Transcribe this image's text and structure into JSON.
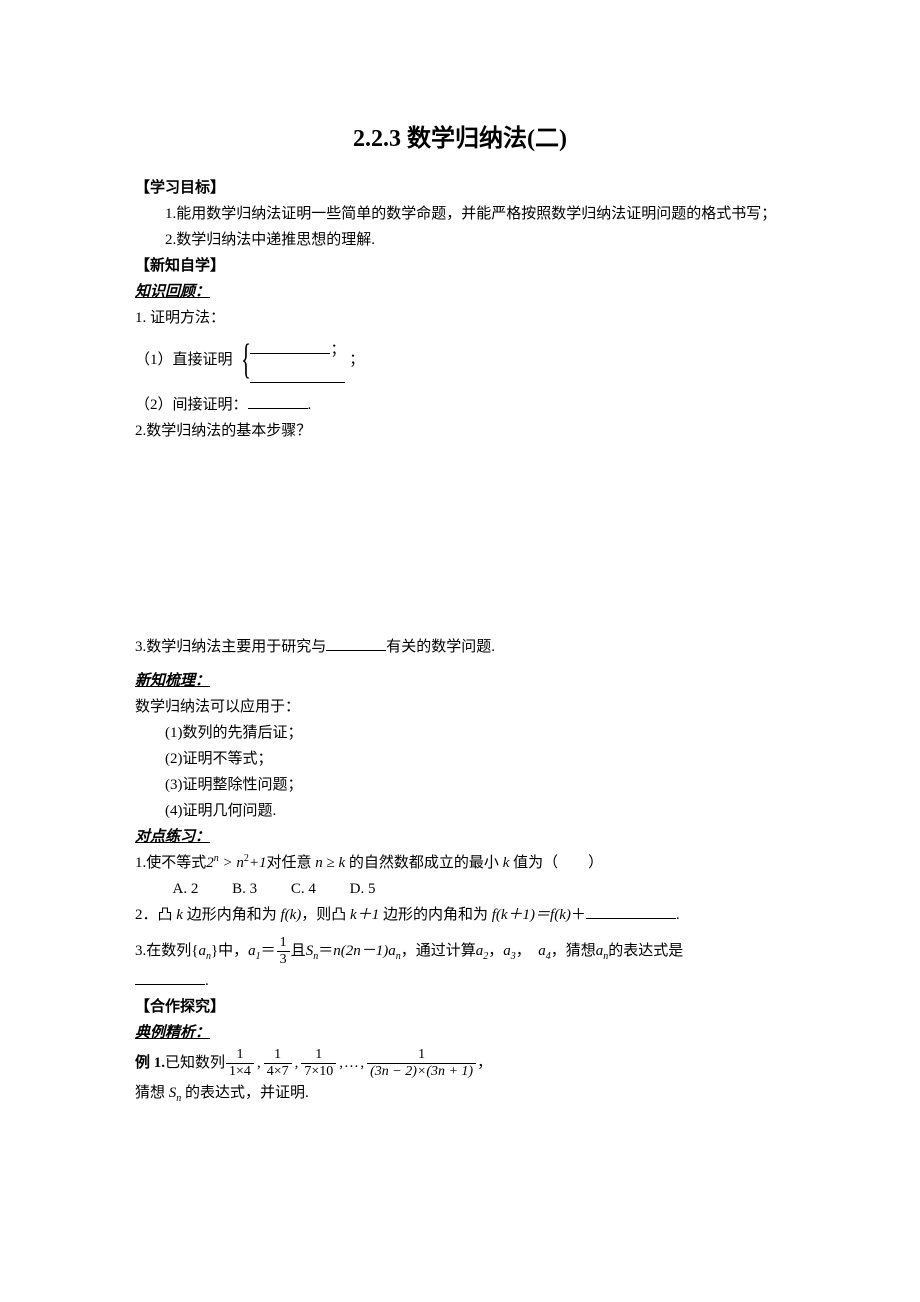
{
  "title": "2.2.3 数学归纳法(二)",
  "sections": {
    "obj_label": "【学习目标】",
    "obj1": "1.能用数学归纳法证明一些简单的数学命题，并能严格按照数学归纳法证明问题的格式书写；",
    "obj2": "2.数学归纳法中递推思想的理解.",
    "newknow_label": "【新知自学】",
    "review_label": "知识回顾：",
    "review1": "1. 证明方法：",
    "review1a": "（1）直接证明",
    "review1b_suffix": "；",
    "review1c_top_suffix": "；",
    "review2": "（2）间接证明：",
    "review2_period": ".",
    "review3": "2.数学归纳法的基本步骤？",
    "review4_pre": "3.数学归纳法主要用于研究与",
    "review4_post": "有关的数学问题.",
    "comb_label": "新知梳理：",
    "comb_intro": "数学归纳法可以应用于：",
    "comb_items": [
      "(1)数列的先猜后证；",
      "(2)证明不等式；",
      "(3)证明整除性问题；",
      "(4)证明几何问题."
    ],
    "exercise_label": "对点练习：",
    "ex1_pre": "1.使不等式",
    "ex1_mid": "对任意",
    "ex1_post": "的自然数都成立的最小",
    "ex1_tail": "值为（　　）",
    "options": {
      "A": "A. 2",
      "B": "B. 3",
      "C": "C. 4",
      "D": "D. 5"
    },
    "ex2_pre": "2．凸",
    "ex2_a": "边形内角和为",
    "ex2_b": "，则凸",
    "ex2_c": "边形的内角和为",
    "ex2_d": "＋",
    "ex2_period": ".",
    "ex3_pre": "3.在数列{",
    "ex3_a": "}中，",
    "ex3_b": "＝",
    "ex3_c": "且",
    "ex3_d": "＝",
    "ex3_e": "，通过计算",
    "ex3_f": "，",
    "ex3_g": "，　",
    "ex3_h": "，猜想",
    "ex3_tail": "的表达式是",
    "ex3_period": ".",
    "coop_label": "【合作探究】",
    "example_label": "典例精析：",
    "example1_label": "例 1.",
    "example1_text": "已知数列",
    "example1_tail": "，",
    "example1_q": "猜想",
    "example1_q2": "的表达式，并证明."
  },
  "math": {
    "ineq1_a": "2",
    "ineq1_b": "n",
    "gt": ">",
    "n2": "n",
    "sq": "2",
    "plus1": "+1",
    "nk": "n ≥ k",
    "k": "k",
    "fk": "f(k)",
    "kplus1": "k＋1",
    "fk1": "f(k＋1)＝f(k)",
    "an": "a",
    "an_sub": "n",
    "a1": "a",
    "a1_sub": "1",
    "one": "1",
    "three": "3",
    "Sn": "S",
    "Sn_sub": "n",
    "n2n1an_a": "n(2n－1)a",
    "n2n1an_sub": "n",
    "a2": "a",
    "a2_sub": "2",
    "a3": "a",
    "a3_sub": "3",
    "a4": "a",
    "a4_sub": "4",
    "frac1": {
      "num": "1",
      "den": "1×4"
    },
    "frac2": {
      "num": "1",
      "den": "4×7"
    },
    "frac3": {
      "num": "1",
      "den": "7×10"
    },
    "dots": "…",
    "frac4": {
      "num": "1",
      "den": "(3n − 2)×(3n + 1)"
    }
  }
}
